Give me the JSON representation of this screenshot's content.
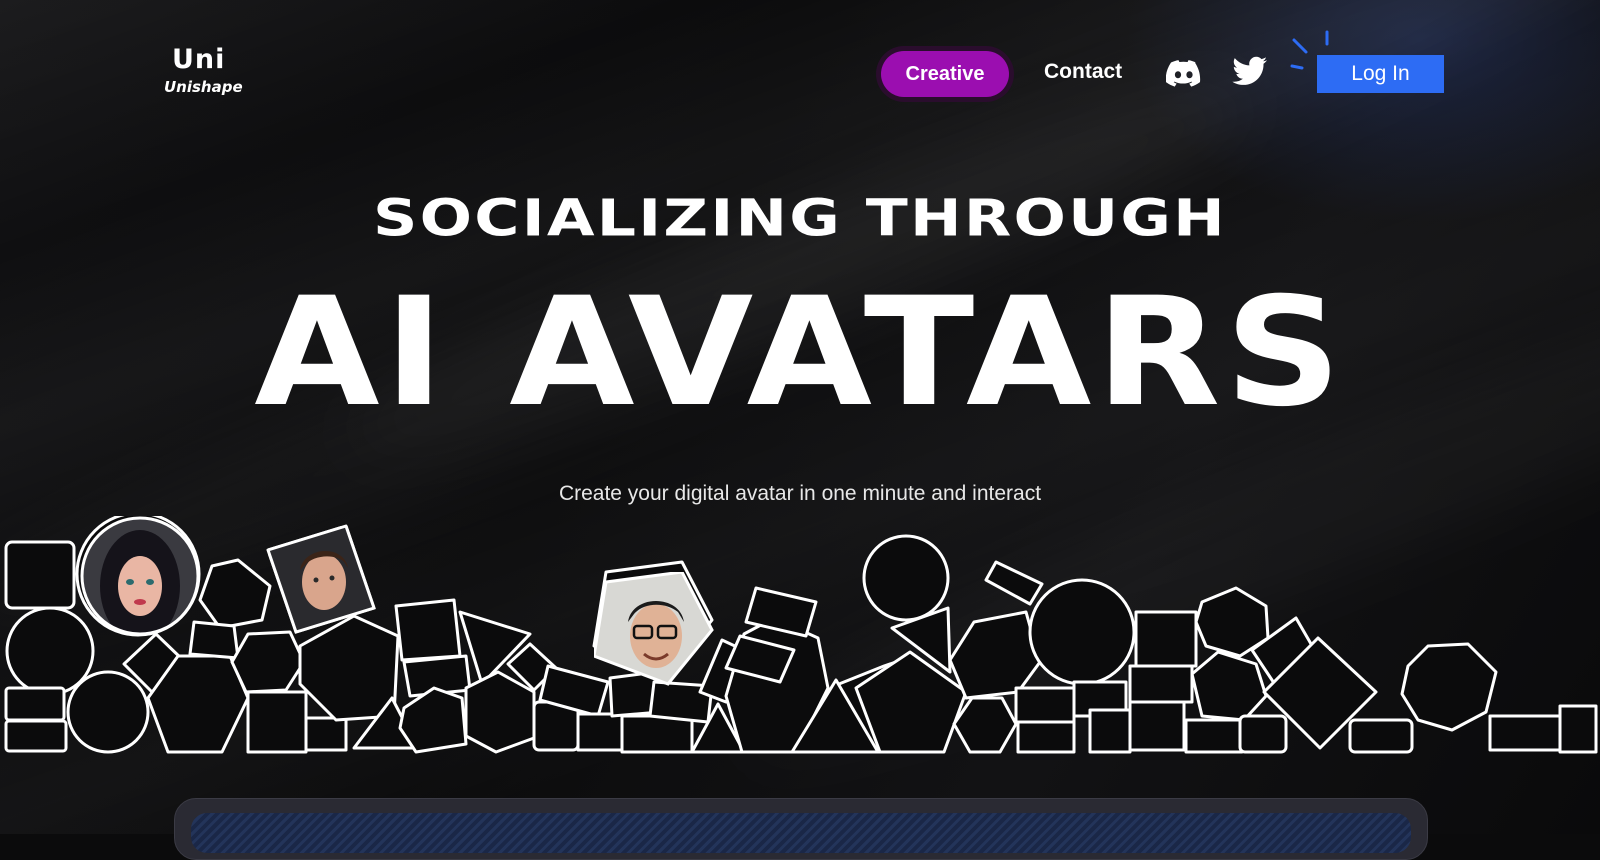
{
  "header": {
    "logo_mark": "Uni",
    "logo_text": "Unishape",
    "nav": {
      "creative": "Creative",
      "contact": "Contact"
    },
    "icons": [
      "discord-icon",
      "twitter-icon"
    ],
    "login": "Log In"
  },
  "hero": {
    "line1": "SOCIALIZING THROUGH",
    "line2": "AI AVATARS",
    "subtitle": "Create your digital avatar in one minute and interact"
  },
  "colors": {
    "background": "#0b0b0c",
    "creative_pill": "#9b0eb0",
    "login_button": "#2d6cf4",
    "shape_stroke": "#ffffff"
  }
}
